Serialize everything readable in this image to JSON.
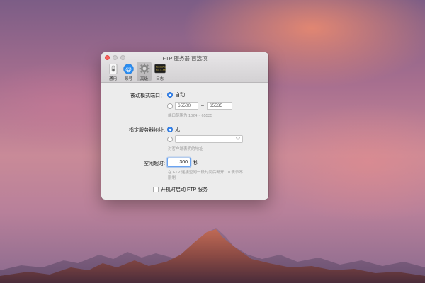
{
  "window": {
    "title": "FTP 服务器 首选项"
  },
  "toolbar": {
    "items": [
      {
        "label": "通用",
        "icon": "switch-icon"
      },
      {
        "label": "账号",
        "icon": "at-sign-icon"
      },
      {
        "label": "高级",
        "icon": "gear-icon",
        "selected": true
      },
      {
        "label": "日志",
        "icon": "console-icon",
        "icon_text": "Console\nv1.7:06"
      }
    ]
  },
  "passive_port": {
    "label": "被动模式端口：",
    "option_auto": "自动",
    "auto_selected": true,
    "range_start": "65500",
    "range_separator": "–",
    "range_end": "65535",
    "hint": "端口范围为 1024 ~ 65535"
  },
  "server_address": {
    "label": "指定服务器地址:",
    "option_none": "无",
    "none_selected": true,
    "custom_value": "",
    "hint": "对客户端表明的地址"
  },
  "idle_timeout": {
    "label": "空闲超时:",
    "value": "300",
    "unit": "秒",
    "hint": "在 FTP 连接空闲一段时间后断开，0 表示不\n限制"
  },
  "startup": {
    "label": "开机时启动 FTP 服务",
    "checked": false
  },
  "colors": {
    "accent": "#3b8af3",
    "close": "#fc605c"
  }
}
